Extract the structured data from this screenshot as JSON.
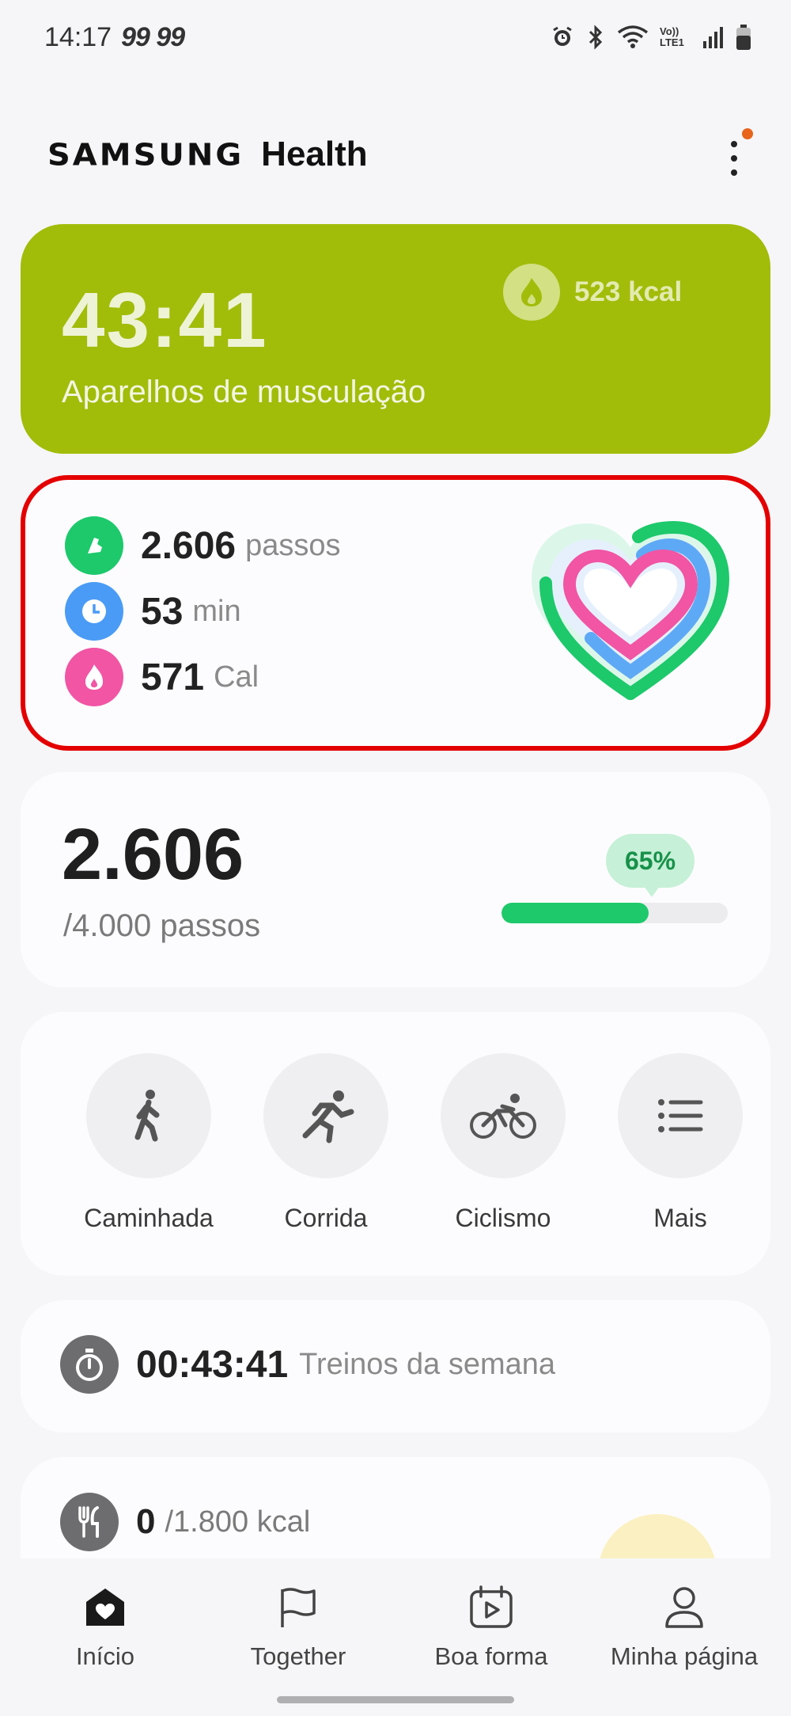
{
  "status_bar": {
    "time": "14:17",
    "extra": "99 99",
    "icons": [
      "alarm-icon",
      "bluetooth-icon",
      "wifi-icon",
      "volte-icon",
      "signal-icon",
      "battery-icon"
    ],
    "volte_label": "Vo)) LTE1"
  },
  "header": {
    "brand": "SAMSUNG",
    "product": "Health",
    "menu_icon": "more-vertical-icon",
    "notification_color": "#e8641b"
  },
  "workout": {
    "duration": "43:41",
    "name": "Aparelhos de musculação",
    "kcal": "523 kcal",
    "color": "#a2bc0a"
  },
  "summary": {
    "rows": [
      {
        "value": "2.606",
        "unit": "passos",
        "icon": "shoe-icon",
        "color": "#1dc96b"
      },
      {
        "value": "53",
        "unit": "min",
        "icon": "clock-icon",
        "color": "#4a9bf5"
      },
      {
        "value": "571",
        "unit": "Cal",
        "icon": "flame-icon",
        "color": "#f155a4"
      }
    ],
    "highlight_color": "#e40000"
  },
  "steps": {
    "count": "2.606",
    "target": "/4.000 passos",
    "percent_label": "65%",
    "progress": 0.65
  },
  "activities": [
    {
      "label": "Caminhada",
      "icon": "walking-icon"
    },
    {
      "label": "Corrida",
      "icon": "running-icon"
    },
    {
      "label": "Ciclismo",
      "icon": "cycling-icon"
    },
    {
      "label": "Mais",
      "icon": "list-icon"
    }
  ],
  "weekly": {
    "value": "00:43:41",
    "label": "Treinos da semana",
    "icon": "stopwatch-icon"
  },
  "food": {
    "value": "0",
    "target": "/1.800 kcal",
    "icon": "fork-knife-icon"
  },
  "nav": [
    {
      "label": "Início",
      "icon": "home-heart-icon",
      "active": true
    },
    {
      "label": "Together",
      "icon": "flag-icon"
    },
    {
      "label": "Boa forma",
      "icon": "calendar-play-icon"
    },
    {
      "label": "Minha página",
      "icon": "person-icon"
    }
  ]
}
